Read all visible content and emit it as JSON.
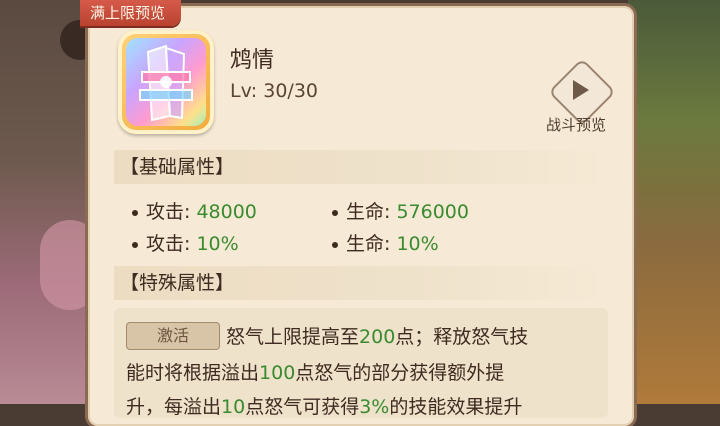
{
  "ribbon": {
    "label": "满上限预览"
  },
  "item": {
    "name": "鸩情",
    "level_label": "Lv:",
    "level_value": "30/30"
  },
  "battle_preview": {
    "label": "战斗预览"
  },
  "sections": {
    "base_title": "【基础属性】",
    "special_title": "【特殊属性】"
  },
  "base_attributes": [
    {
      "label": "攻击:",
      "value": "48000"
    },
    {
      "label": "生命:",
      "value": "576000"
    },
    {
      "label": "攻击:",
      "value": "10%"
    },
    {
      "label": "生命:",
      "value": "10%"
    }
  ],
  "special": {
    "badge": "激活",
    "line1_a": "怒气上限提高至",
    "line1_b": "200",
    "line1_c": "点；释放怒气技",
    "line2_a": "能时将根据溢出",
    "line2_b": "100",
    "line2_c": "点怒气的部分获得额外提",
    "line3_a": "升，每溢出",
    "line3_b": "10",
    "line3_c": "点怒气可获得",
    "line3_d": "3%",
    "line3_e": "的技能效果提升"
  },
  "colors": {
    "accent_green": "#3a8a2f",
    "ribbon_red": "#c94a38",
    "panel_bg": "#f6ead6"
  },
  "icons": {
    "item": "rainbow-crystal-icon",
    "battle": "play-icon"
  }
}
